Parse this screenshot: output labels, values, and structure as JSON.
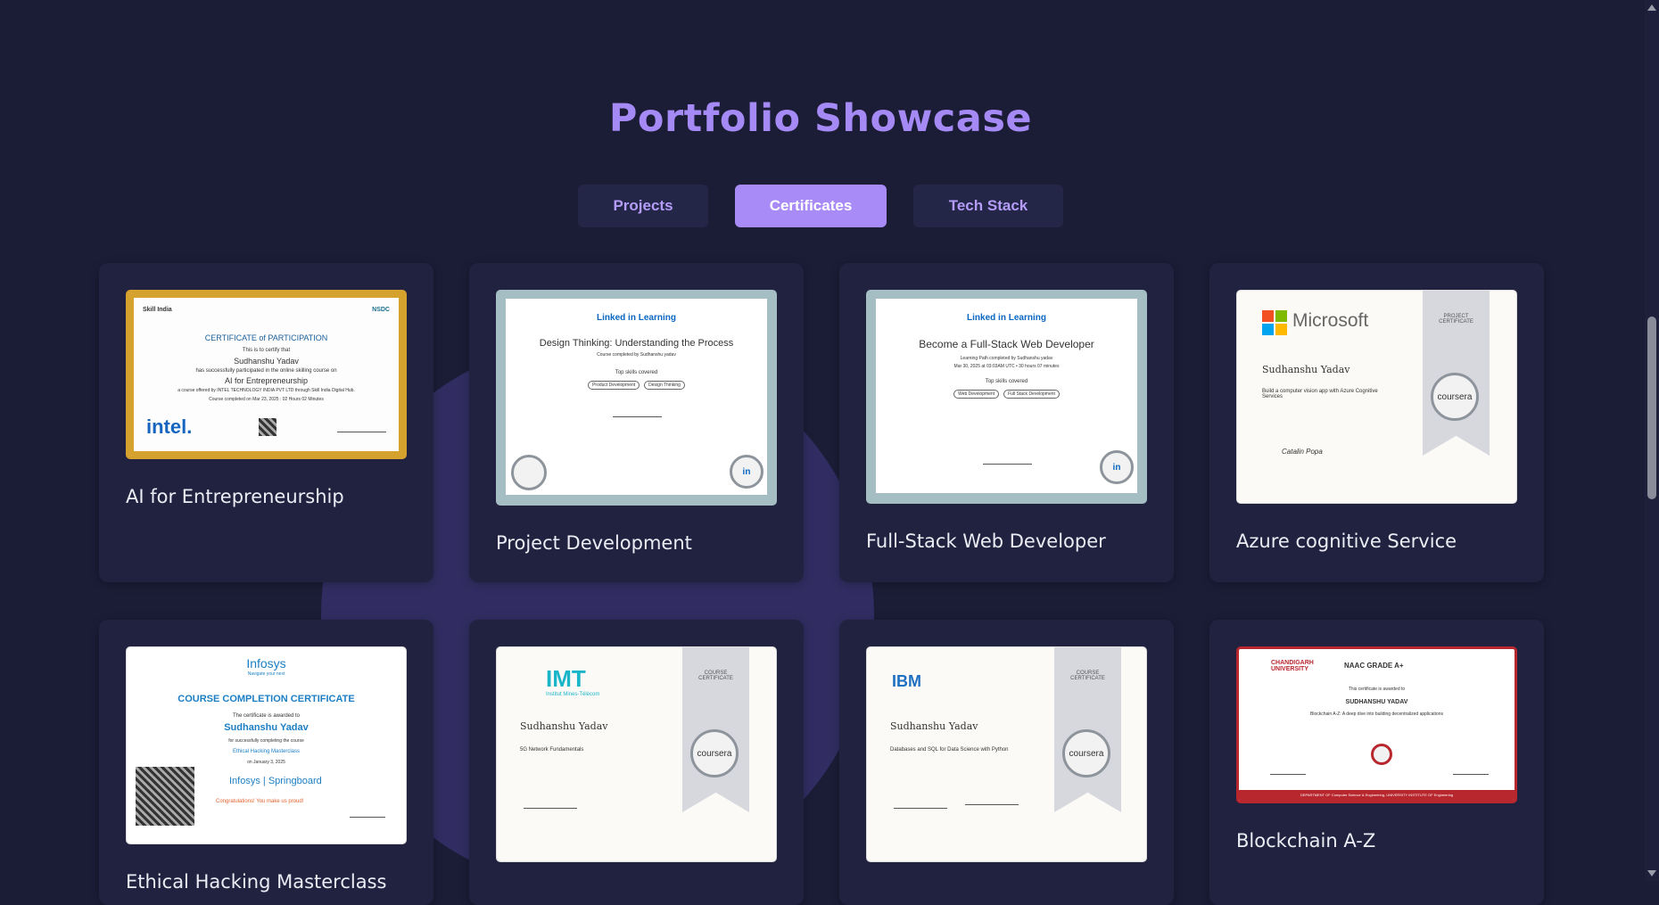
{
  "header": {
    "title": "Portfolio Showcase"
  },
  "tabs": [
    {
      "label": "Projects",
      "active": false
    },
    {
      "label": "Certificates",
      "active": true
    },
    {
      "label": "Tech Stack",
      "active": false
    }
  ],
  "colors": {
    "background": "#1b1c36",
    "card": "#21223f",
    "accent": "#a88bf7",
    "title": "#a58af5"
  },
  "certificates": [
    {
      "title": "AI for Entrepreneurship",
      "image": {
        "header_left": "Skill India",
        "header_right": "NSDC",
        "heading": "CERTIFICATE of PARTICIPATION",
        "line1": "This is to certify that",
        "name": "Sudhanshu Yadav",
        "line2": "has successfully participated in the online skilling course on",
        "course": "AI for Entrepreneurship",
        "line3": "a course offered by INTEL TECHNOLOGY INDIA PVT LTD through Skill India Digital Hub.",
        "line4": "Course completed on Mar 23, 2025 : 02 Hours 02 Minutes",
        "logo": "intel."
      }
    },
    {
      "title": "Project Development",
      "image": {
        "brand": "Linked in Learning",
        "course": "Design Thinking: Understanding the Process",
        "line1": "Course completed by Sudhanshu yadav",
        "line2": "Top skills covered",
        "skills": [
          "Product Development",
          "Design Thinking"
        ]
      }
    },
    {
      "title": "Full-Stack Web Developer",
      "image": {
        "brand": "Linked in Learning",
        "course": "Become a Full-Stack Web Developer",
        "line1": "Learning Path completed by Sudhanshu yadav",
        "line2": "Mar 30, 2025 at 03:03AM UTC • 30 hours 07 minutes",
        "line3": "Top skills covered",
        "skills": [
          "Web Development",
          "Full Stack Development"
        ]
      }
    },
    {
      "title": "Azure cognitive Service",
      "image": {
        "brand": "Microsoft",
        "ribbon": "PROJECT CERTIFICATE",
        "name": "Sudhanshu Yadav",
        "line1": "Build a computer vision app with Azure Cognitive Services",
        "seal": "coursera",
        "signature": "Catalin Popa"
      }
    },
    {
      "title": "Ethical Hacking Masterclass",
      "image": {
        "brand": "Infosys",
        "tagline": "Navigate your next",
        "heading": "COURSE COMPLETION CERTIFICATE",
        "line1": "The certificate is awarded to",
        "name": "Sudhanshu Yadav",
        "line2": "for successfully completing the course",
        "course": "Ethical Hacking Masterclass",
        "line3": "on January 3, 2025",
        "logo": "Infosys | Springboard",
        "congrats": "Congratulations! You make us proud!"
      }
    },
    {
      "title": "",
      "image": {
        "brand": "IMT",
        "brand_sub": "Institut Mines-Télécom",
        "ribbon": "COURSE CERTIFICATE",
        "name": "Sudhanshu Yadav",
        "course": "5G Network Fundamentals",
        "seal": "coursera"
      }
    },
    {
      "title": "",
      "image": {
        "brand": "IBM",
        "ribbon": "COURSE CERTIFICATE",
        "name": "Sudhanshu Yadav",
        "course": "Databases and SQL for Data Science with Python",
        "seal": "coursera"
      }
    },
    {
      "title": "Blockchain A-Z",
      "image": {
        "brand": "CHANDIGARH UNIVERSITY",
        "badge": "NAAC GRADE A+",
        "line1": "This certificate is awarded to",
        "name": "SUDHANSHU YADAV",
        "course": "Blockchain A-Z: A deep dive into building decentralized applications",
        "footer": "DEPARTMENT OF Computer Science & Engineering, UNIVERSITY INSTITUTE OF Engineering"
      }
    }
  ]
}
